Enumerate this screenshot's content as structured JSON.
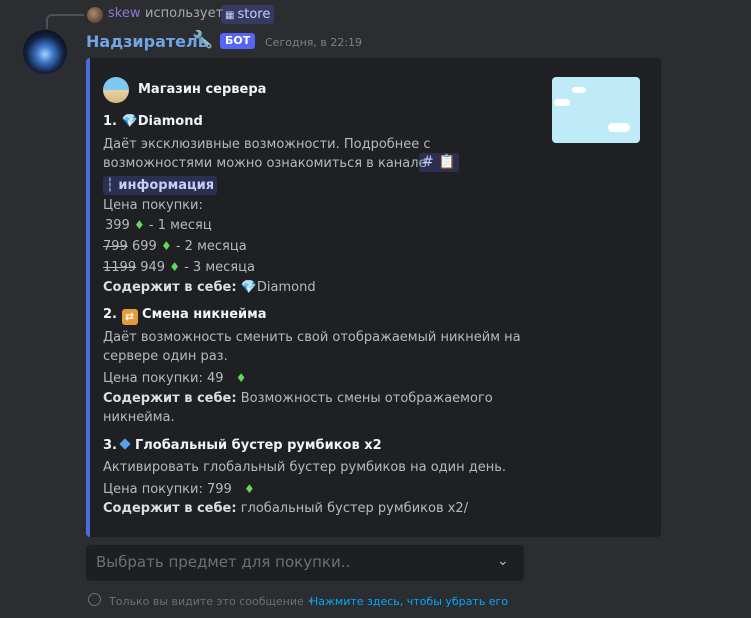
{
  "reply": {
    "username": "skew",
    "uses_text": "использует",
    "command": "store"
  },
  "message": {
    "author": "Надзиратель",
    "badge": "БОТ",
    "timestamp": "Сегодня, в 22:19"
  },
  "embed": {
    "author_name": "Магазин сервера",
    "accent_color": "#4a6ce3",
    "items": [
      {
        "heading_prefix": "1.",
        "heading_title": "Diamond",
        "description_line1": "Даёт эксклюзивные возможности. Подробнее с",
        "description_line2": "возможностями можно ознакомиться в канале",
        "channel": "информация",
        "price_label": "Цена покупки:",
        "prices": [
          {
            "old": "",
            "new": "399",
            "period": "- 1 месяц"
          },
          {
            "old": "799",
            "new": "699",
            "period": "- 2 месяца"
          },
          {
            "old": "1199",
            "new": "949",
            "period": "- 3 месяца"
          }
        ],
        "contains_label": "Содержит в себе:",
        "contains_value": "Diamond"
      },
      {
        "heading_prefix": "2.",
        "heading_title": "Смена никнейма",
        "description_line1": "Даёт возможность сменить свой отображаемый никнейм на",
        "description_line2": "сервере один раз.",
        "price_label": "Цена покупки:",
        "price": "49",
        "contains_label": "Содержит в себе:",
        "contains_line1": "Возможность смены отображаемого",
        "contains_line2": "никнейма."
      },
      {
        "heading_prefix": "3.",
        "heading_title": "Глобальный бустер румбиков x2",
        "description_line1": "Активировать глобальный бустер румбиков на один день.",
        "price_label": "Цена покупки:",
        "price": "799",
        "contains_label": "Содержит в себе:",
        "contains_value": "глобальный бустер румбиков x2/"
      }
    ]
  },
  "select": {
    "placeholder": "Выбрать предмет для покупки.."
  },
  "ephemeral": {
    "note": "Только вы видите это сообщение •",
    "dismiss": "Нажмите здесь, чтобы убрать его"
  },
  "icons": {
    "diamond": "gem-icon",
    "currency": "green-gem-icon",
    "nick_change": "swap-icon",
    "booster": "blue-diamond-icon"
  }
}
